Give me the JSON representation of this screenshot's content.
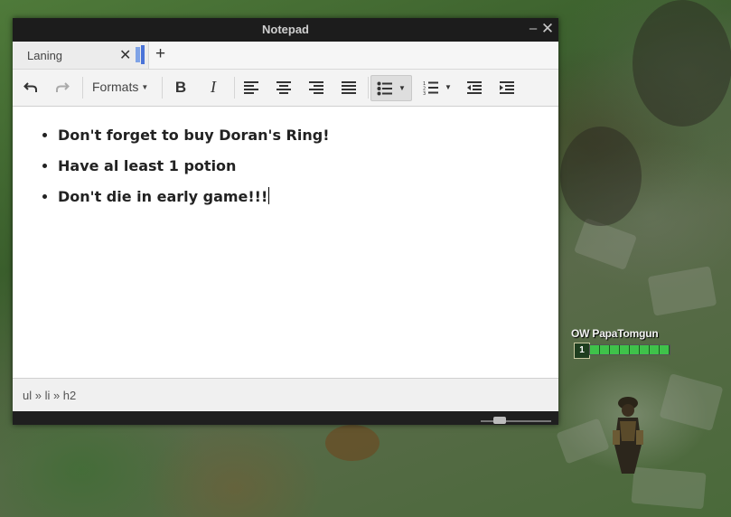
{
  "window": {
    "title": "Notepad"
  },
  "tabs": [
    {
      "label": "Laning"
    }
  ],
  "toolbar": {
    "formats_label": "Formats"
  },
  "document": {
    "items": [
      "Don't forget to buy Doran's Ring!",
      "Have al least 1 potion",
      "Don't die in early game!!!"
    ]
  },
  "status": {
    "path": "ul » li » h2"
  },
  "game_hud": {
    "player_name": "OW PapaTomgun",
    "level": "1",
    "health_fraction": 1.0
  },
  "colors": {
    "accent": "#4a73d8",
    "titlebar": "#1c1c1c",
    "hud_health": "#3fc24a"
  }
}
